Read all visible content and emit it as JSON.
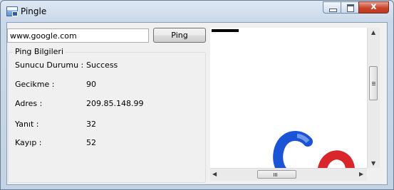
{
  "window": {
    "title": "Pingle",
    "icon": "window-app-icon",
    "controls": [
      "minimize-icon",
      "maximize-icon",
      "close-icon"
    ],
    "close_glyph": "x"
  },
  "form": {
    "url_value": "www.google.com",
    "ping_label": "Ping"
  },
  "group": {
    "title": "Ping Bilgileri",
    "rows": [
      {
        "label": "Sunucu Durumu :",
        "value": "Success"
      },
      {
        "label": "Gecikme :",
        "value": "90"
      },
      {
        "label": "Adres :",
        "value": "209.85.148.99"
      },
      {
        "label": "Yanıt :",
        "value": "32"
      },
      {
        "label": "Kayıp :",
        "value": "52"
      }
    ]
  },
  "browser": {
    "content": "google-logo-partial",
    "scrollbar_grip_glyph": "III",
    "colors": {
      "blue": "#1a53d6",
      "red": "#d8262b"
    }
  }
}
